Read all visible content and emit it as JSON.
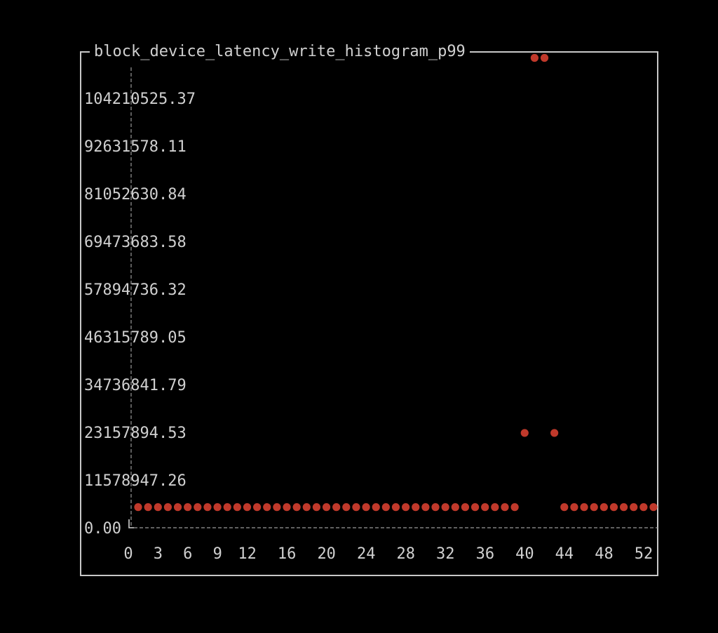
{
  "chart_data": {
    "type": "scatter",
    "title": "block_device_latency_write_histogram_p99",
    "xlabel": "",
    "ylabel": "",
    "ylim": [
      0,
      110000000
    ],
    "xlim": [
      0,
      53
    ],
    "x_ticks": [
      "0",
      "3",
      "6",
      "9",
      "12",
      "16",
      "20",
      "24",
      "28",
      "32",
      "36",
      "40",
      "44",
      "48",
      "52"
    ],
    "y_ticks": [
      "0.00",
      "11578947.26",
      "23157894.53",
      "34736841.79",
      "46315789.05",
      "57894736.32",
      "69473683.58",
      "81052630.84",
      "92631578.11",
      "104210525.37"
    ],
    "series": [
      {
        "color": "#c0392b",
        "points": [
          [
            1,
            5000000
          ],
          [
            2,
            5000000
          ],
          [
            3,
            5000000
          ],
          [
            4,
            5000000
          ],
          [
            5,
            5000000
          ],
          [
            6,
            5000000
          ],
          [
            7,
            5000000
          ],
          [
            8,
            5000000
          ],
          [
            9,
            5000000
          ],
          [
            10,
            5000000
          ],
          [
            11,
            5000000
          ],
          [
            12,
            5000000
          ],
          [
            13,
            5000000
          ],
          [
            14,
            5000000
          ],
          [
            15,
            5000000
          ],
          [
            16,
            5000000
          ],
          [
            17,
            5000000
          ],
          [
            18,
            5000000
          ],
          [
            19,
            5000000
          ],
          [
            20,
            5000000
          ],
          [
            21,
            5000000
          ],
          [
            22,
            5000000
          ],
          [
            23,
            5000000
          ],
          [
            24,
            5000000
          ],
          [
            25,
            5000000
          ],
          [
            26,
            5000000
          ],
          [
            27,
            5000000
          ],
          [
            28,
            5000000
          ],
          [
            29,
            5000000
          ],
          [
            30,
            5000000
          ],
          [
            31,
            5000000
          ],
          [
            32,
            5000000
          ],
          [
            33,
            5000000
          ],
          [
            34,
            5000000
          ],
          [
            35,
            5000000
          ],
          [
            36,
            5000000
          ],
          [
            37,
            5000000
          ],
          [
            38,
            5000000
          ],
          [
            39,
            5000000
          ],
          [
            40,
            23000000
          ],
          [
            41,
            114000000
          ],
          [
            42,
            114000000
          ],
          [
            43,
            23000000
          ],
          [
            44,
            5000000
          ],
          [
            45,
            5000000
          ],
          [
            46,
            5000000
          ],
          [
            47,
            5000000
          ],
          [
            48,
            5000000
          ],
          [
            49,
            5000000
          ],
          [
            50,
            5000000
          ],
          [
            51,
            5000000
          ],
          [
            52,
            5000000
          ],
          [
            53,
            5000000
          ]
        ]
      }
    ],
    "grid": false,
    "legend": "none"
  }
}
